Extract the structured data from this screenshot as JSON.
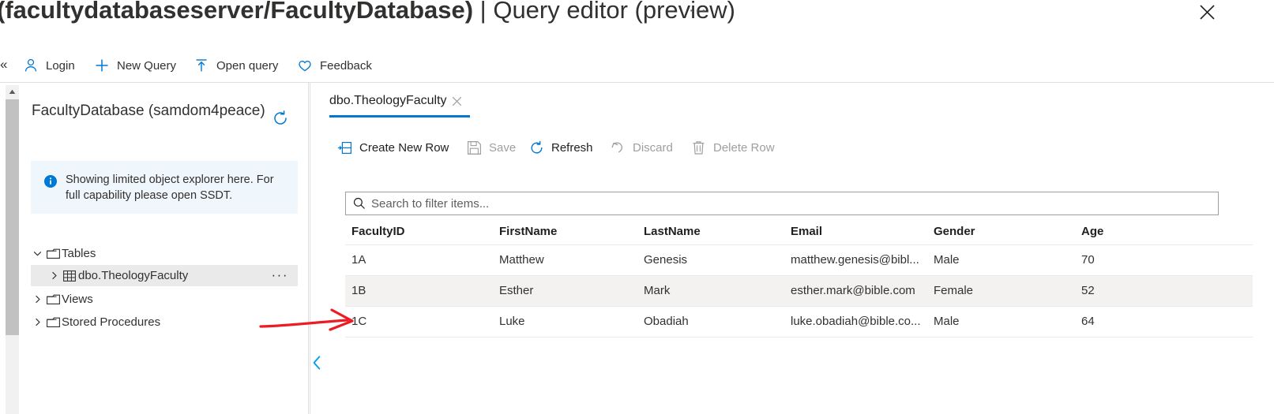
{
  "header": {
    "title_main": "(facultydatabaseserver/FacultyDatabase)",
    "title_sep": " | ",
    "title_sub": "Query editor (preview)",
    "overflow_label": "···",
    "close_label": "Close"
  },
  "commandbar": {
    "collapse_label": "«",
    "items": [
      {
        "label": "Login",
        "icon": "person-icon"
      },
      {
        "label": "New Query",
        "icon": "plus-icon"
      },
      {
        "label": "Open query",
        "icon": "upload-arrow-icon"
      },
      {
        "label": "Feedback",
        "icon": "heart-icon"
      }
    ]
  },
  "explorer": {
    "database_name": "FacultyDatabase (samdom4peace)",
    "refresh_icon": "refresh-icon",
    "info_banner": {
      "icon": "info-icon",
      "text": "Showing limited object explorer here. For full capability please open SSDT."
    },
    "tree": [
      {
        "label": "Tables",
        "twisty": "∨",
        "icon": "folder-icon",
        "expanded": true,
        "selected": false
      },
      {
        "label": "dbo.TheologyFaculty",
        "twisty": "›",
        "icon": "table-icon",
        "expanded": false,
        "selected": true,
        "ellipsis": "···"
      },
      {
        "label": "Views",
        "twisty": "›",
        "icon": "folder-icon",
        "expanded": false,
        "selected": false
      },
      {
        "label": "Stored Procedures",
        "twisty": "›",
        "icon": "folder-icon",
        "expanded": false,
        "selected": false
      }
    ],
    "collapse_pane_icon": "chevron-left-icon"
  },
  "editor": {
    "tab": {
      "label": "dbo.TheologyFaculty",
      "close_icon": "close-icon"
    },
    "toolbar": [
      {
        "label": "Create New Row",
        "icon": "insert-row-icon",
        "enabled": true
      },
      {
        "label": "Save",
        "icon": "save-icon",
        "enabled": false
      },
      {
        "label": "Refresh",
        "icon": "refresh-icon",
        "enabled": true
      },
      {
        "label": "Discard",
        "icon": "undo-icon",
        "enabled": false
      },
      {
        "label": "Delete Row",
        "icon": "trash-icon",
        "enabled": false
      }
    ],
    "search": {
      "placeholder": "Search to filter items...",
      "value": "",
      "icon": "search-icon"
    },
    "grid": {
      "columns": [
        "FacultyID",
        "FirstName",
        "LastName",
        "Email",
        "Gender",
        "Age"
      ],
      "rows": [
        [
          "1A",
          "Matthew",
          "Genesis",
          "matthew.genesis@bibl...",
          "Male",
          "70"
        ],
        [
          "1B",
          "Esther",
          "Mark",
          "esther.mark@bible.com",
          "Female",
          "52"
        ],
        [
          "1C",
          "Luke",
          "Obadiah",
          "luke.obadiah@bible.co...",
          "Male",
          "64"
        ]
      ]
    }
  },
  "annotation": {
    "arrow_color": "#ed1c24",
    "points_to": "1C"
  },
  "colors": {
    "accent": "#0078d4",
    "info_banner_bg": "#eff6fc",
    "row_alt_bg": "#f3f2f1",
    "selected_node_bg": "#eaeaea",
    "border": "#e1dfdd",
    "disabled_text": "#a19f9d"
  }
}
